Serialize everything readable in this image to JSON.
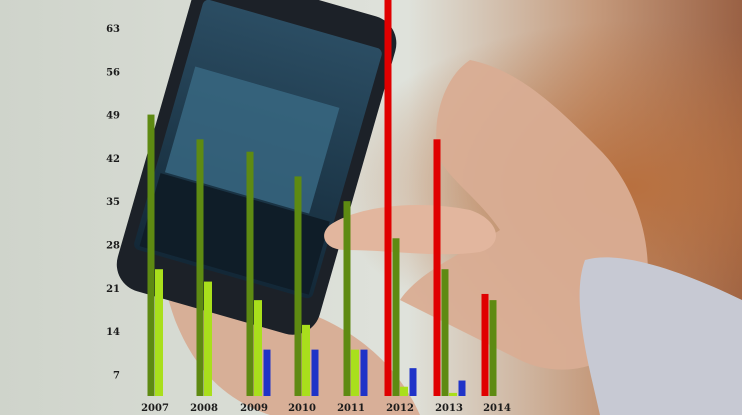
{
  "chart_data": {
    "type": "bar",
    "categories": [
      "2007",
      "2008",
      "2009",
      "2010",
      "2011",
      "2012",
      "2013",
      "2014"
    ],
    "series": [
      {
        "values": [
          49,
          45,
          43,
          39,
          35,
          29,
          24,
          19
        ],
        "color": "#5e8a12"
      },
      {
        "values": [
          24,
          22,
          19,
          15,
          11,
          5,
          4,
          1
        ],
        "color": "#a9df1c"
      },
      {
        "values": [
          null,
          null,
          null,
          null,
          null,
          70,
          45,
          20
        ],
        "color": "#e00000"
      },
      {
        "values": [
          null,
          null,
          11,
          11,
          11,
          8,
          6,
          3
        ],
        "color": "#1f33c8"
      }
    ],
    "y_ticks": [
      7,
      14,
      21,
      28,
      35,
      42,
      49,
      56,
      63
    ],
    "ylim": [
      3.5,
      63
    ],
    "grid": false,
    "legend": "none",
    "background": "photo of hands typing a text message on a smartphone"
  }
}
